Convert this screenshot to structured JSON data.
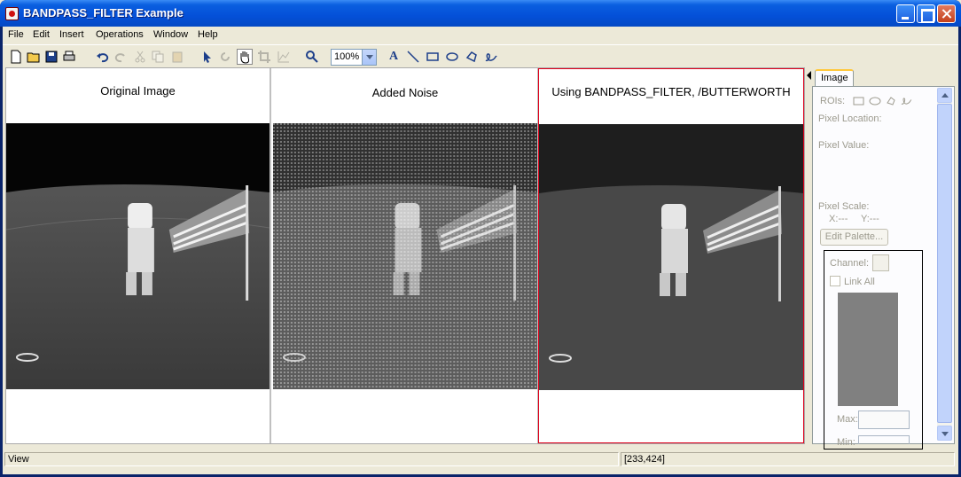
{
  "window": {
    "title": "BANDPASS_FILTER Example"
  },
  "menu": [
    "File",
    "Edit",
    "Insert",
    "Operations",
    "Window",
    "Help"
  ],
  "toolbar": {
    "zoom": "100%",
    "tools": [
      "new-file",
      "open",
      "save",
      "print",
      "undo",
      "redo",
      "cut",
      "copy",
      "paste",
      "select",
      "rotate",
      "pan",
      "crop",
      "line-profile",
      "zoom",
      "text",
      "line",
      "rectangle",
      "ellipse",
      "polygon",
      "freehand"
    ]
  },
  "panels": [
    {
      "title": "Original Image"
    },
    {
      "title": "Added Noise"
    },
    {
      "title": "Using BANDPASS_FILTER, /BUTTERWORTH"
    }
  ],
  "sidebar": {
    "tab": "Image",
    "rois_label": "ROIs:",
    "pixel_location": "Pixel Location:",
    "pixel_value": "Pixel Value:",
    "pixel_scale": "Pixel Scale:",
    "x_label": "X:---",
    "y_label": "Y:---",
    "edit_palette": "Edit Palette...",
    "channel": "Channel:",
    "link_all": "Link All",
    "max_label": "Max:",
    "min_label": "Min:"
  },
  "status": {
    "left": "View",
    "right": "[233,424]"
  }
}
